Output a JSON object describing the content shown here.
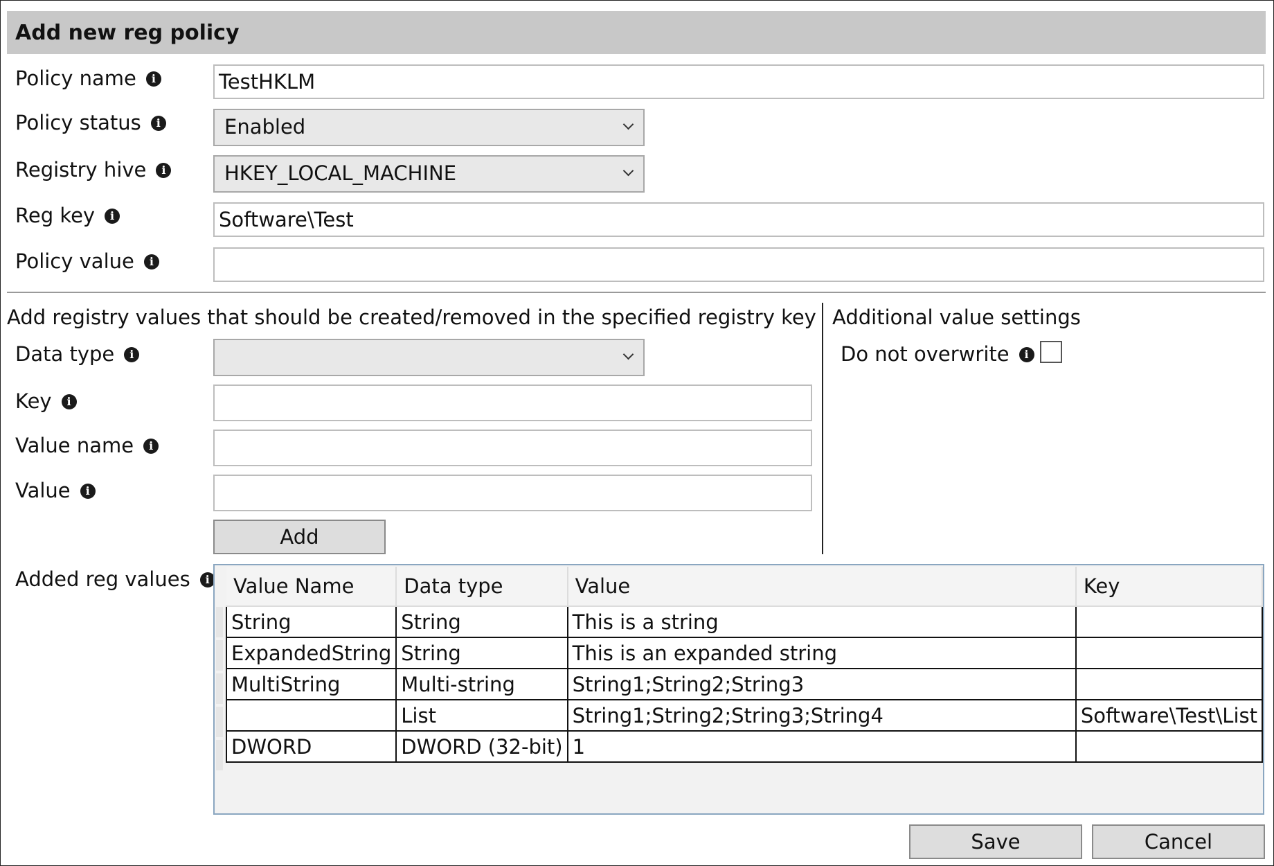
{
  "window": {
    "title": "Add new reg policy"
  },
  "fields": {
    "policy_name": {
      "label": "Policy name",
      "value": "TestHKLM"
    },
    "policy_status": {
      "label": "Policy status",
      "value": "Enabled"
    },
    "registry_hive": {
      "label": "Registry hive",
      "value": "HKEY_LOCAL_MACHINE"
    },
    "reg_key": {
      "label": "Reg key",
      "value": "Software\\Test"
    },
    "policy_value": {
      "label": "Policy value",
      "value": ""
    }
  },
  "values_section": {
    "heading": "Add registry values that should be created/removed in the specified registry key",
    "data_type": {
      "label": "Data type",
      "value": ""
    },
    "key": {
      "label": "Key",
      "value": ""
    },
    "value_name": {
      "label": "Value name",
      "value": ""
    },
    "value": {
      "label": "Value",
      "value": ""
    },
    "add_label": "Add"
  },
  "additional": {
    "heading": "Additional value settings",
    "do_not_overwrite": {
      "label": "Do not overwrite",
      "checked": false
    }
  },
  "added_values": {
    "label": "Added reg values",
    "columns": [
      "Value Name",
      "Data type",
      "Value",
      "Key"
    ],
    "rows": [
      [
        "String",
        "String",
        "This is a string",
        ""
      ],
      [
        "ExpandedString",
        "String",
        "This is an expanded string",
        ""
      ],
      [
        "MultiString",
        "Multi-string",
        "String1;String2;String3",
        ""
      ],
      [
        "",
        "List",
        "String1;String2;String3;String4",
        "Software\\Test\\List"
      ],
      [
        "DWORD",
        "DWORD (32-bit)",
        "1",
        ""
      ]
    ]
  },
  "footer": {
    "save_label": "Save",
    "cancel_label": "Cancel"
  },
  "icons": {
    "info": "info-icon",
    "dropdown": "chevron-down-icon"
  }
}
